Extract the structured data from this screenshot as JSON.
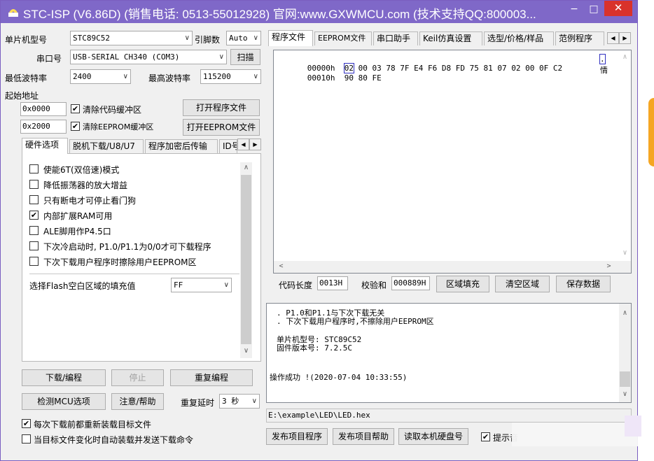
{
  "titlebar": {
    "title": "STC-ISP (V6.86D) (销售电话: 0513-55012928) 官网:www.GXWMCU.com (技术支持QQ:800003...",
    "min": "−",
    "max": "□",
    "close": "✕"
  },
  "left": {
    "mcu_type_label": "单片机型号",
    "mcu_type_value": "STC89C52",
    "pin_label": "引脚数",
    "pin_value": "Auto",
    "port_label": "串口号",
    "port_value": "USB-SERIAL CH340 (COM3)",
    "scan_button": "扫描",
    "min_baud_label": "最低波特率",
    "min_baud_value": "2400",
    "max_baud_label": "最高波特率",
    "max_baud_value": "115200",
    "start_addr_label": "起始地址",
    "addr1": "0x0000",
    "addr2": "0x2000",
    "clear_code_label": "清除代码缓冲区",
    "clear_eeprom_label": "清除EEPROM缓冲区",
    "open_program": "打开程序文件",
    "open_eeprom": "打开EEPROM文件",
    "tabs": [
      "硬件选项",
      "脱机下载/U8/U7",
      "程序加密后传输",
      "ID号"
    ],
    "options": [
      {
        "label": "使能6T(双倍速)模式",
        "checked": false
      },
      {
        "label": "降低振荡器的放大增益",
        "checked": false
      },
      {
        "label": "只有断电才可停止看门狗",
        "checked": false
      },
      {
        "label": "内部扩展RAM可用",
        "checked": true
      },
      {
        "label": "ALE脚用作P4.5口",
        "checked": false
      },
      {
        "label": "下次冷启动时, P1.0/P1.1为0/0才可下载程序",
        "checked": false
      },
      {
        "label": "下次下载用户程序时擦除用户EEPROM区",
        "checked": false
      }
    ],
    "fill_label": "选择Flash空白区域的填充值",
    "fill_value": "FF",
    "download_button": "下载/编程",
    "stop_button": "停止",
    "reprogram_button": "重复编程",
    "detect_button": "检测MCU选项",
    "help_button": "注意/帮助",
    "delay_label": "重复延时",
    "delay_value": "3 秒",
    "reload_label": "每次下载前都重新装载目标文件",
    "reload_checked": true,
    "auto_label": "当目标文件变化时自动装载并发送下载命令",
    "auto_checked": false
  },
  "right": {
    "tabs": [
      "程序文件",
      "EEPROM文件",
      "串口助手",
      "Keil仿真设置",
      "选型/价格/样品",
      "范例程序"
    ],
    "hex_rows": [
      {
        "addr": "00000h",
        "bytes": [
          "02",
          "00",
          "03",
          "78",
          "7F",
          "E4",
          "F6",
          "D8",
          "FD",
          "75",
          "81",
          "07",
          "02",
          "00",
          "0F",
          "C2"
        ],
        "ascii": "."
      },
      {
        "addr": "00010h",
        "bytes": [
          "90",
          "80",
          "FE"
        ],
        "ascii": ""
      }
    ],
    "side_char": "情",
    "code_len_label": "代码长度",
    "code_len_value": "0013H",
    "checksum_label": "校验和",
    "checksum_value": "000889H",
    "fill_area_button": "区域填充",
    "clear_area_button": "清空区域",
    "save_data_button": "保存数据",
    "log_lines": [
      ". P1.0和P1.1与下次下载无关",
      ". 下次下载用户程序时,不擦除用户EEPROM区",
      "单片机型号: STC89C52",
      "固件版本号: 7.2.5C"
    ],
    "status": "操作成功 !(2020-07-04 10:33:55)",
    "file_path": "E:\\example\\LED\\LED.hex",
    "publish_button": "发布项目程序",
    "publish_help_button": "发布项目帮助",
    "read_disk_button": "读取本机硬盘号",
    "hint_label": "提示音",
    "hint_checked": true
  }
}
